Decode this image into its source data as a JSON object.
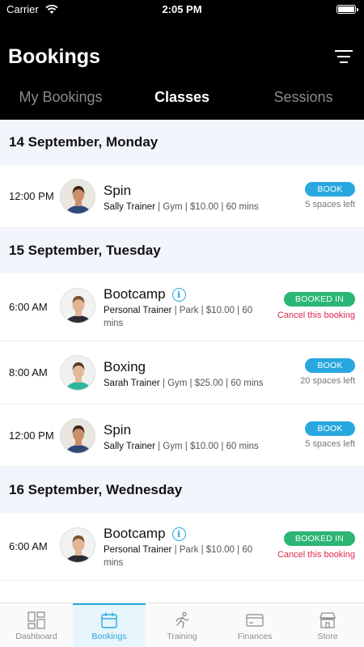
{
  "status_bar": {
    "carrier": "Carrier",
    "time": "2:05 PM"
  },
  "header": {
    "title": "Bookings"
  },
  "tabs": [
    {
      "label": "My Bookings",
      "active": false
    },
    {
      "label": "Classes",
      "active": true
    },
    {
      "label": "Sessions",
      "active": false
    }
  ],
  "days": [
    {
      "date": "14 September, Monday",
      "bookings": [
        {
          "time": "12:00 PM",
          "class": "Spin",
          "trainer": "Sally Trainer",
          "details": " | Gym | $10.00 | 60 mins",
          "action": "BOOK",
          "spaces": "5 spaces left"
        }
      ]
    },
    {
      "date": "15 September, Tuesday",
      "bookings": [
        {
          "time": "6:00 AM",
          "class": "Bootcamp",
          "trainer": "Personal Trainer",
          "details": " | Park | $10.00 | 60 mins",
          "action": "BOOKED IN",
          "cancel": "Cancel this booking"
        },
        {
          "time": "8:00 AM",
          "class": "Boxing",
          "trainer": "Sarah Trainer",
          "details": " | Gym | $25.00 | 60 mins",
          "action": "BOOK",
          "spaces": "20 spaces left"
        },
        {
          "time": "12:00 PM",
          "class": "Spin",
          "trainer": "Sally Trainer",
          "details": " | Gym | $10.00 | 60 mins",
          "action": "BOOK",
          "spaces": "5 spaces left"
        }
      ]
    },
    {
      "date": "16 September, Wednesday",
      "bookings": [
        {
          "time": "6:00 AM",
          "class": "Bootcamp",
          "trainer": "Personal Trainer",
          "details": " | Park | $10.00 | 60 mins",
          "action": "BOOKED IN",
          "cancel": "Cancel this booking"
        }
      ]
    }
  ],
  "tab_bar": [
    {
      "label": "Dashboard",
      "icon": "dashboard-icon",
      "active": false
    },
    {
      "label": "Bookings",
      "icon": "calendar-icon",
      "active": true
    },
    {
      "label": "Training",
      "icon": "running-person-icon",
      "active": false
    },
    {
      "label": "Finances",
      "icon": "card-icon",
      "active": false
    },
    {
      "label": "Store",
      "icon": "store-icon",
      "active": false
    }
  ],
  "colors": {
    "accent": "#29a8e0",
    "booked": "#2bb673",
    "cancel": "#e0284a",
    "header_bg": "#000000",
    "day_bg": "#f2f5fb"
  }
}
